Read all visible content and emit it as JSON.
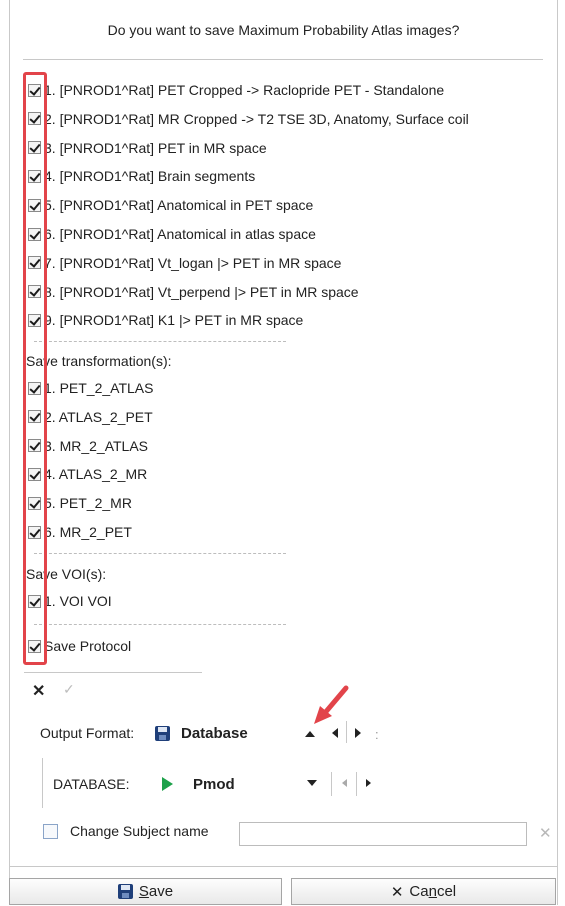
{
  "dialog": {
    "question": "Do you want to save Maximum Probability Atlas images?"
  },
  "images": [
    {
      "label": "1. [PNROD1^Rat] PET Cropped -> Raclopride PET - Standalone",
      "checked": true
    },
    {
      "label": "2. [PNROD1^Rat] MR Cropped -> T2 TSE 3D, Anatomy, Surface coil",
      "checked": true
    },
    {
      "label": "3. [PNROD1^Rat] PET in MR space",
      "checked": true
    },
    {
      "label": "4. [PNROD1^Rat] Brain segments",
      "checked": true
    },
    {
      "label": "5. [PNROD1^Rat] Anatomical in PET space",
      "checked": true
    },
    {
      "label": "6. [PNROD1^Rat] Anatomical in atlas space",
      "checked": true
    },
    {
      "label": "7. [PNROD1^Rat] Vt_logan |> PET in MR space",
      "checked": true
    },
    {
      "label": "8. [PNROD1^Rat] Vt_perpend |> PET in MR space",
      "checked": true
    },
    {
      "label": "9. [PNROD1^Rat] K1 |> PET in MR space",
      "checked": true
    }
  ],
  "transformations": {
    "title": "Save transformation(s):",
    "items": [
      {
        "label": "1. PET_2_ATLAS",
        "checked": true
      },
      {
        "label": "2. ATLAS_2_PET",
        "checked": true
      },
      {
        "label": "3. MR_2_ATLAS",
        "checked": true
      },
      {
        "label": "4. ATLAS_2_MR",
        "checked": true
      },
      {
        "label": "5. PET_2_MR",
        "checked": true
      },
      {
        "label": "6. MR_2_PET",
        "checked": true
      }
    ]
  },
  "vois": {
    "title": "Save VOI(s):",
    "items": [
      {
        "label": "1. VOI VOI",
        "checked": true
      }
    ]
  },
  "protocol": {
    "label": "Save Protocol",
    "checked": true
  },
  "toolbar": {
    "deselect_icon": "close-icon",
    "select_icon": "check-icon"
  },
  "output": {
    "label": "Output Format:",
    "value": "Database",
    "icon": "floppy-disk-icon",
    "suffix": ":"
  },
  "database": {
    "label": "DATABASE:",
    "value": "Pmod",
    "icon": "play-icon"
  },
  "change_subject": {
    "label": "Change Subject name",
    "value": "",
    "checked": false
  },
  "buttons": {
    "save_prefix": "",
    "save_mnemonic": "S",
    "save_rest": "ave",
    "cancel_prefix": "Ca",
    "cancel_mnemonic": "n",
    "cancel_rest": "cel"
  },
  "colors": {
    "highlight": "#e2444a",
    "play": "#1da14a",
    "floppy": "#1f3f7a"
  }
}
